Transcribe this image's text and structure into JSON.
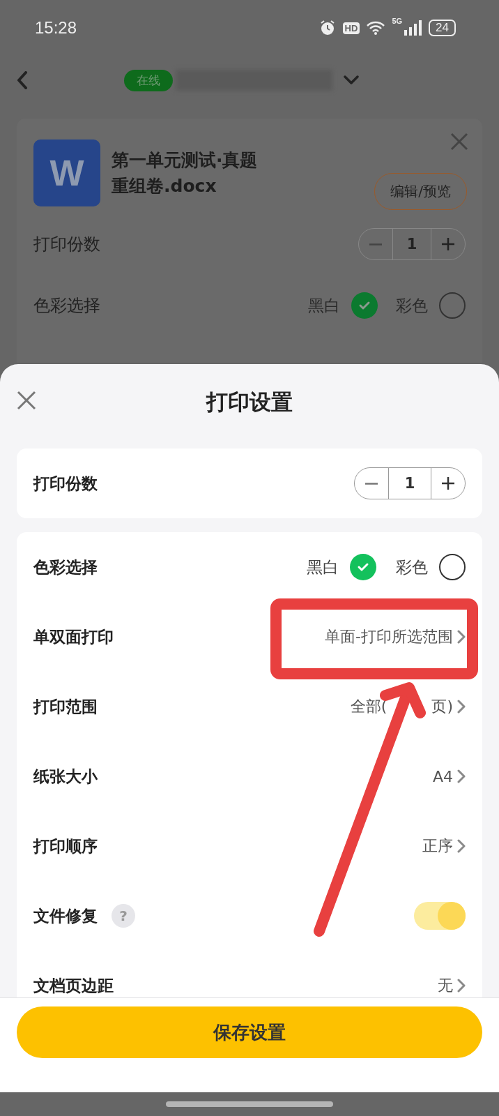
{
  "status_bar": {
    "time": "15:28",
    "hd": "HD",
    "network": "5G",
    "battery": "24"
  },
  "nav": {
    "status_badge": "在线"
  },
  "background_card": {
    "file_name": "第一单元测试·真题重组卷.docx",
    "file_icon": "W",
    "edit_button": "编辑/预览",
    "copies": {
      "label": "打印份数",
      "value": "1"
    },
    "color": {
      "label": "色彩选择",
      "options": [
        {
          "label": "黑白",
          "selected": true
        },
        {
          "label": "彩色",
          "selected": false
        }
      ]
    }
  },
  "sheet": {
    "title": "打印设置",
    "copies": {
      "label": "打印份数",
      "value": "1"
    },
    "rows": [
      {
        "kind": "options",
        "label": "色彩选择",
        "options": [
          {
            "label": "黑白",
            "selected": true
          },
          {
            "label": "彩色",
            "selected": false
          }
        ]
      },
      {
        "kind": "link",
        "label": "单双面打印",
        "value": "单面-打印所选范围"
      },
      {
        "kind": "link",
        "label": "打印范围",
        "value": "全部(",
        "value_end": "页)"
      },
      {
        "kind": "link",
        "label": "纸张大小",
        "value": "A4"
      },
      {
        "kind": "link",
        "label": "打印顺序",
        "value": "正序"
      },
      {
        "kind": "toggle",
        "label": "文件修复",
        "help": "?",
        "on": true
      },
      {
        "kind": "link",
        "label": "文档页边距",
        "value": "无"
      }
    ],
    "save_button": "保存设置"
  }
}
